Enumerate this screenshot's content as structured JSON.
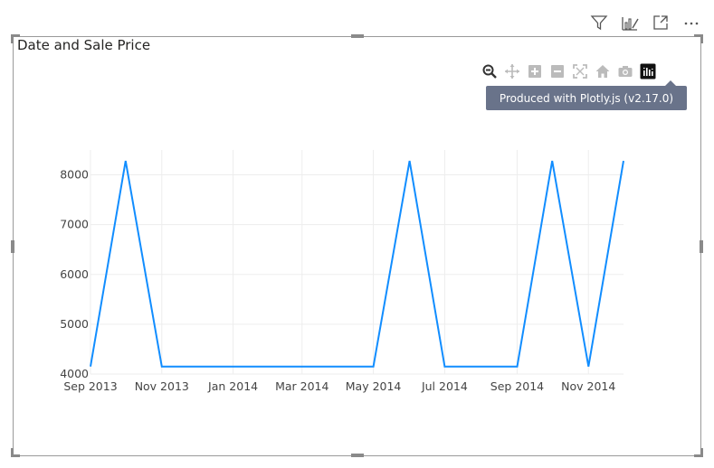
{
  "visual": {
    "title": "Date and Sale Price"
  },
  "header_icons": [
    {
      "name": "filter-icon"
    },
    {
      "name": "chart-analytics-icon"
    },
    {
      "name": "focus-mode-icon"
    },
    {
      "name": "more-options-icon"
    }
  ],
  "modebar": [
    {
      "name": "zoom-icon",
      "active": true
    },
    {
      "name": "pan-icon",
      "active": false
    },
    {
      "name": "zoom-in-icon",
      "active": false
    },
    {
      "name": "zoom-out-icon",
      "active": false
    },
    {
      "name": "autoscale-icon",
      "active": false
    },
    {
      "name": "reset-axes-icon",
      "active": false
    },
    {
      "name": "camera-icon",
      "active": false
    },
    {
      "name": "plotly-logo-icon",
      "active": true
    }
  ],
  "tooltip": {
    "text": "Produced with Plotly.js (v2.17.0)"
  },
  "chart_data": {
    "type": "line",
    "title": "",
    "xlabel": "",
    "ylabel": "",
    "x": [
      "2013-09-01",
      "2013-10-01",
      "2013-11-01",
      "2013-12-01",
      "2014-01-01",
      "2014-02-01",
      "2014-03-01",
      "2014-04-01",
      "2014-05-01",
      "2014-06-01",
      "2014-07-01",
      "2014-08-01",
      "2014-09-01",
      "2014-10-01",
      "2014-11-01",
      "2014-12-01"
    ],
    "series": [
      {
        "values": [
          4150,
          8280,
          4150,
          4150,
          4150,
          4150,
          4150,
          4150,
          4150,
          8280,
          4150,
          4150,
          4150,
          8280,
          4150,
          8280
        ],
        "color": "#118dff"
      }
    ],
    "xlim": [
      "2013-09-01",
      "2014-12-01"
    ],
    "ylim": [
      4000,
      8500
    ],
    "yticks": [
      4000,
      5000,
      6000,
      7000,
      8000
    ],
    "xticks": [
      {
        "date": "2013-09-01",
        "label": "Sep 2013"
      },
      {
        "date": "2013-11-01",
        "label": "Nov 2013"
      },
      {
        "date": "2014-01-01",
        "label": "Jan 2014"
      },
      {
        "date": "2014-03-01",
        "label": "Mar 2014"
      },
      {
        "date": "2014-05-01",
        "label": "May 2014"
      },
      {
        "date": "2014-07-01",
        "label": "Jul 2014"
      },
      {
        "date": "2014-09-01",
        "label": "Sep 2014"
      },
      {
        "date": "2014-11-01",
        "label": "Nov 2014"
      }
    ],
    "grid": true,
    "legend": "none"
  }
}
